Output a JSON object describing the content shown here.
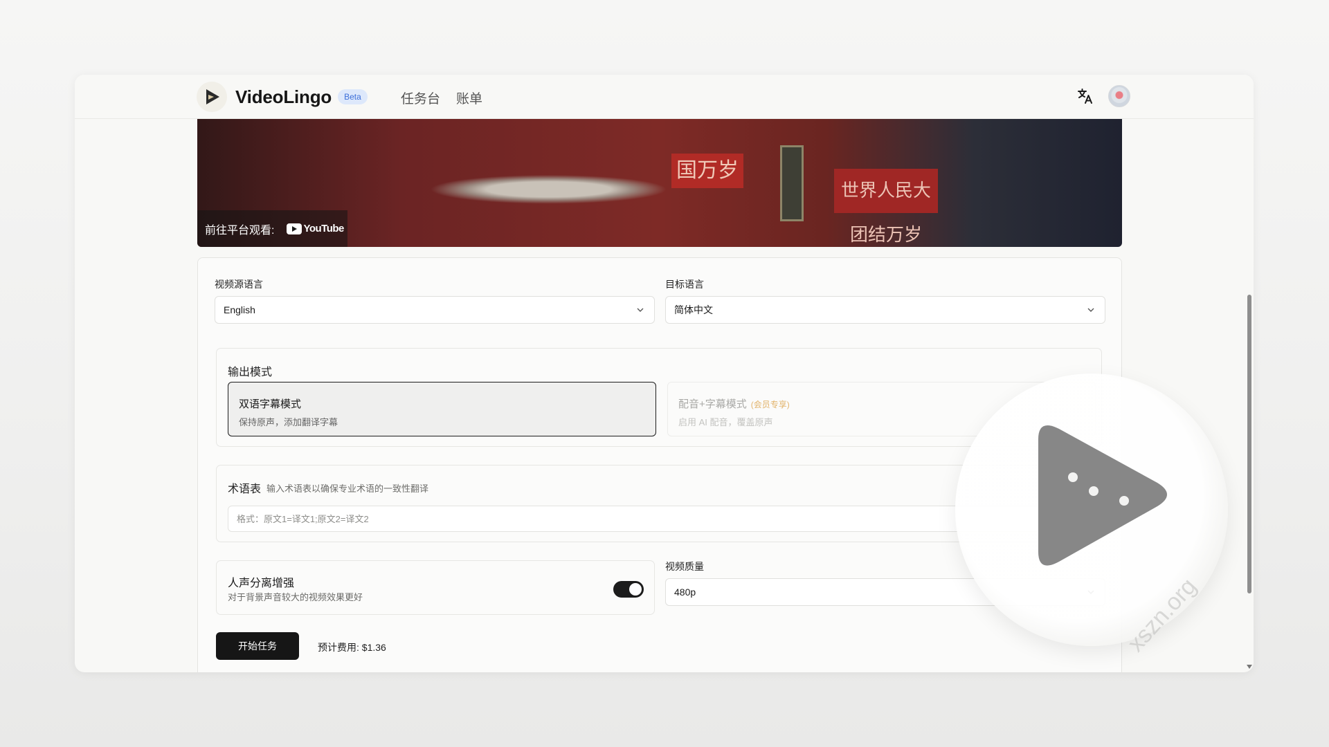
{
  "header": {
    "brand": "VideoLingo",
    "badge": "Beta",
    "nav": [
      "任务台",
      "账单"
    ],
    "icons": [
      "translate-icon",
      "avatar"
    ]
  },
  "video": {
    "watch_label": "前往平台观看:",
    "platform": "YouTube",
    "scene_text_1": "国万岁",
    "scene_text_2": "世界人民大团结万岁"
  },
  "form": {
    "source_language_label": "视频源语言",
    "source_language_value": "English",
    "target_language_label": "目标语言",
    "target_language_value": "简体中文",
    "output_mode": {
      "title": "输出模式",
      "options": [
        {
          "title": "双语字幕模式",
          "desc": "保持原声，添加翻译字幕",
          "selected": true
        },
        {
          "title": "配音+字幕模式",
          "tag": "(会员专享)",
          "desc": "启用 AI 配音，覆盖原声",
          "selected": false
        }
      ]
    },
    "glossary": {
      "title": "术语表",
      "desc": "输入术语表以确保专业术语的一致性翻译",
      "placeholder": "格式：原文1=译文1;原文2=译文2"
    },
    "vocal": {
      "title": "人声分离增强",
      "desc": "对于背景声音较大的视频效果更好",
      "enabled": true
    },
    "quality": {
      "label": "视频质量",
      "value": "480p"
    },
    "start_button": "开始任务",
    "cost": "预计费用: $1.36"
  },
  "overlay": {
    "watermark": "xszn.org"
  }
}
